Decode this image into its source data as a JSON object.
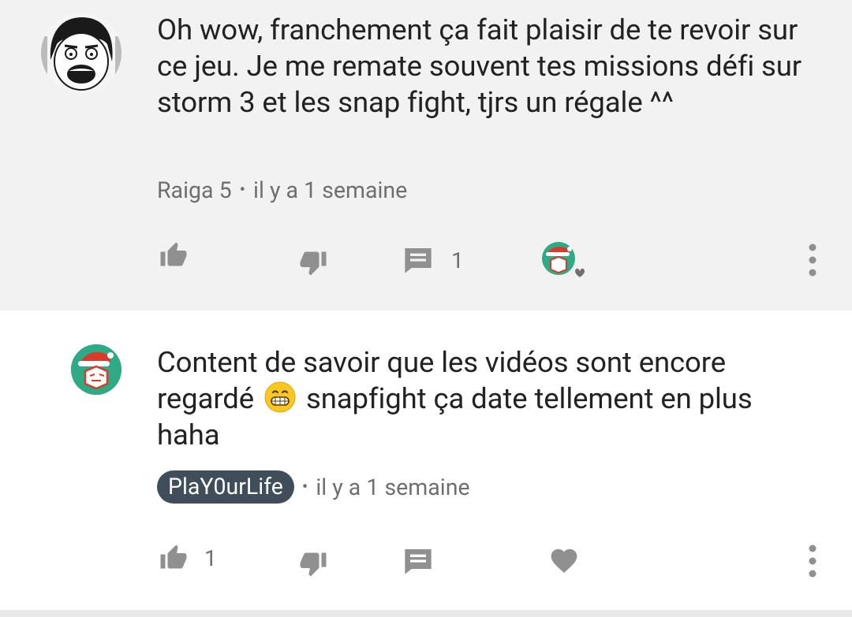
{
  "comments": [
    {
      "text": "Oh wow, franchement ça fait plaisir de te revoir sur ce jeu. Je me remate souvent tes missions défi sur storm 3 et les snap fight, tjrs un régale ^^",
      "author": "Raiga 5",
      "separator": "•",
      "time": "il y a 1 semaine",
      "reply_count": "1",
      "like_count": ""
    },
    {
      "text_before_emoji": "Content de savoir que les vidéos sont encore regardé",
      "emoji": "grinning-face-emoji",
      "text_after_emoji": "snapfight ça date tellement en plus haha",
      "author": "PlaY0urLife",
      "separator": "•",
      "time": "il y a 1 semaine",
      "like_count": "1"
    }
  ],
  "colors": {
    "top_bg": "#f2f2f2",
    "text": "#222222",
    "meta": "#6f6f6f",
    "icon": "#909090",
    "author_badge": "#3f4e5a"
  }
}
